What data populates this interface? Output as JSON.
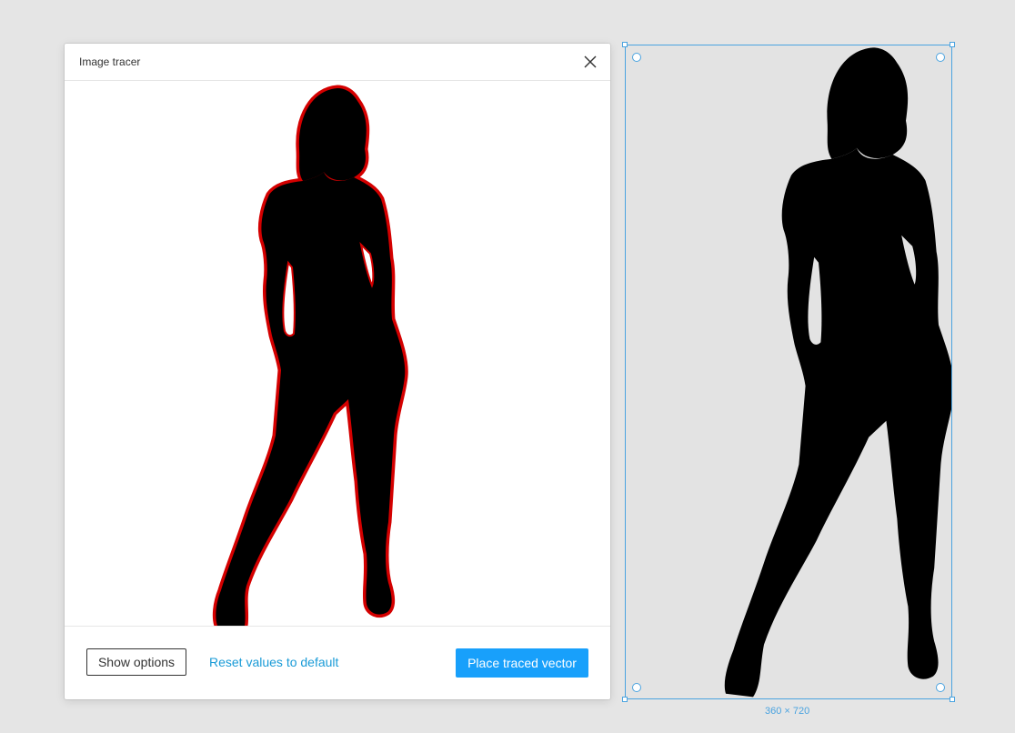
{
  "dialog": {
    "title": "Image tracer",
    "close_icon": "close-icon",
    "footer": {
      "show_options_label": "Show options",
      "reset_label": "Reset values to default",
      "place_label": "Place traced vector"
    }
  },
  "canvas": {
    "frame_dimensions": "360 × 720"
  },
  "colors": {
    "accent": "#18a0fb",
    "link": "#1a9bd7",
    "selection": "#4aa3e0",
    "trace_outline": "#d40000",
    "silhouette": "#000000",
    "canvas_bg": "#e5e5e5"
  },
  "icons": [
    "close-icon",
    "silhouette-preview-image",
    "traced-vector-silhouette"
  ]
}
